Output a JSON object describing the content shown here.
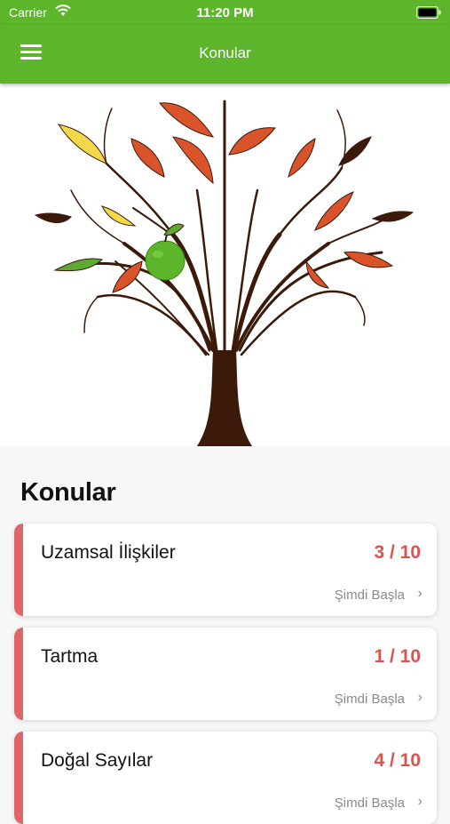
{
  "status_bar": {
    "carrier": "Carrier",
    "time": "11:20 PM"
  },
  "nav": {
    "title": "Konular",
    "menu_icon": "hamburger-menu-icon"
  },
  "hero": {
    "image": "tree-illustration"
  },
  "section": {
    "title": "Konular"
  },
  "topics": [
    {
      "name": "Uzamsal İlişkiler",
      "score": "3 / 10",
      "action": "Şimdi Başla"
    },
    {
      "name": "Tartma",
      "score": "1 / 10",
      "action": "Şimdi Başla"
    },
    {
      "name": "Doğal Sayılar",
      "score": "4 / 10",
      "action": "Şimdi Başla"
    }
  ],
  "colors": {
    "brand": "#5cb52a",
    "accent": "#e06567",
    "score": "#d9534f"
  }
}
